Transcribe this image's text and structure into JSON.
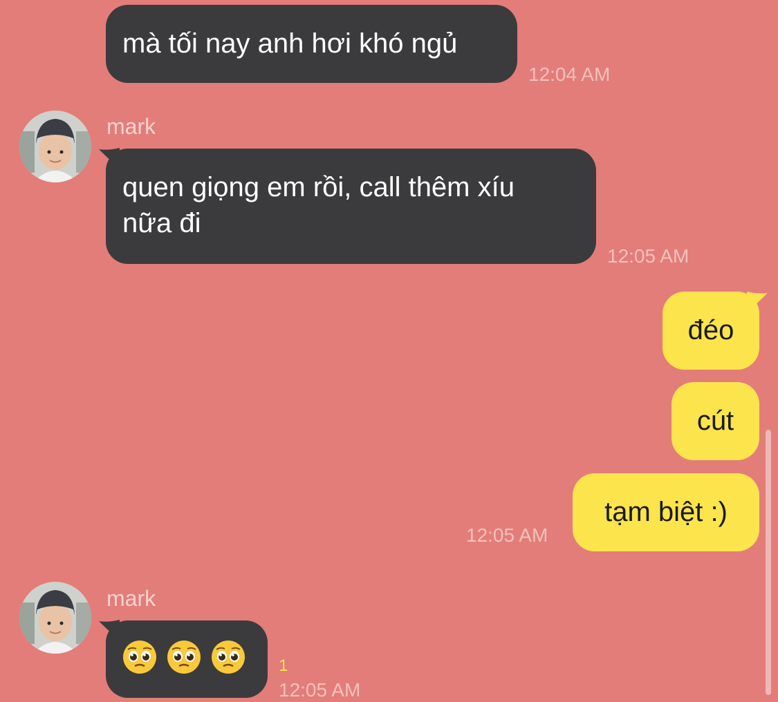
{
  "colors": {
    "background": "#e37d79",
    "incoming_bubble": "#3b3b3d",
    "outgoing_bubble": "#fbe44c",
    "timestamp": "#f2c1bc",
    "unread_count": "#fbe44c"
  },
  "messages": [
    {
      "direction": "incoming",
      "text": "mà tối nay anh hơi khó ngủ",
      "time": "12:04 AM"
    },
    {
      "direction": "incoming",
      "sender": "mark",
      "line1": "quen giọng em rồi, call thêm xíu",
      "line2": "nữa đi",
      "time": "12:05 AM"
    },
    {
      "direction": "outgoing",
      "text": "đéo"
    },
    {
      "direction": "outgoing",
      "text": "cút"
    },
    {
      "direction": "outgoing",
      "text": "tạm biệt :)",
      "time": "12:05 AM"
    },
    {
      "direction": "incoming",
      "sender": "mark",
      "emoji": "pleading-face-emoji x3",
      "unread": "1",
      "time": "12:05 AM"
    }
  ]
}
